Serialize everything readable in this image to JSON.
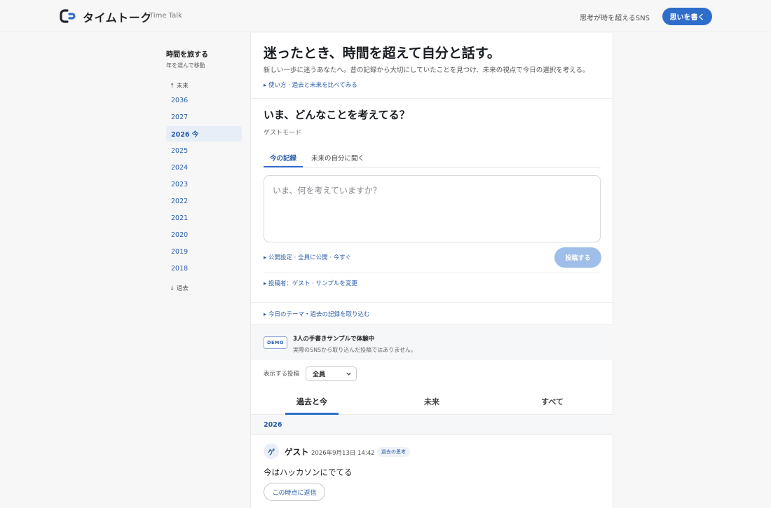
{
  "header": {
    "brand_name": "タイムトーク",
    "brand_sub": "Time Talk",
    "tagline": "思考が時を超えるSNS",
    "write_button": "思いを書く"
  },
  "sidebar": {
    "title": "時間を旅する",
    "subtitle": "年を選んで移動",
    "future_link": "↑ 未来",
    "past_link": "↓ 過去",
    "years": [
      {
        "label": "2036"
      },
      {
        "label": "2027"
      },
      {
        "label": "2026 今",
        "current": true
      },
      {
        "label": "2025"
      },
      {
        "label": "2024"
      },
      {
        "label": "2023"
      },
      {
        "label": "2022"
      },
      {
        "label": "2021"
      },
      {
        "label": "2020"
      },
      {
        "label": "2019"
      },
      {
        "label": "2018"
      }
    ]
  },
  "hero": {
    "title": "迷ったとき、時間を超えて自分と話す。",
    "description": "新しい一歩に迷うあなたへ。昔の記録から大切にしていたことを見つけ、未来の視点で今日の選択を考える。",
    "howto_link": "▸ 使い方 · 過去と未来を比べてみる"
  },
  "composer": {
    "question": "いま、どんなことを考えてる？",
    "mode": "ゲストモード",
    "tabs": [
      "今の記録",
      "未来の自分に聞く"
    ],
    "placeholder": "いま、何を考えていますか？",
    "visibility_link": "▸ 公開設定 · 全員に公開 · 今すぐ",
    "post_button": "投稿する",
    "author_link": "▸ 投稿者：ゲスト · サンプルを変更",
    "theme_link": "▸ 今日のテーマ・過去の記録を取り込む"
  },
  "demo": {
    "badge": "DEMO",
    "title": "3人の手書きサンプルで体験中",
    "subtitle": "実際のSNSから取り込んだ投稿ではありません。"
  },
  "filter": {
    "label": "表示する投稿",
    "selected": "全員"
  },
  "feed_tabs": [
    "過去と今",
    "未来",
    "すべて"
  ],
  "feed": {
    "year_header": "2026",
    "post": {
      "avatar": "ゲ",
      "author": "ゲスト",
      "timestamp": "2026年9月13日 14:42",
      "tag": "過去の思考",
      "body": "今はハッカソンにでてる",
      "reply_button": "この時点に返信"
    }
  },
  "colors": {
    "accent": "#2f6dcc",
    "link": "#2a5ea8",
    "post_button_disabled": "#9fbfea"
  }
}
